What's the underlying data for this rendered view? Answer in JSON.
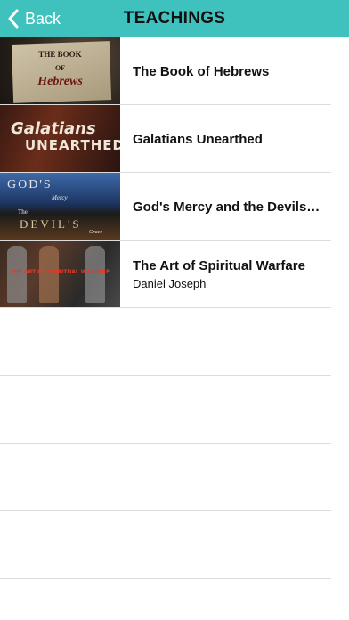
{
  "nav": {
    "back_label": "Back",
    "title": "TEACHINGS"
  },
  "items": [
    {
      "title": "The Book of Hebrews",
      "subtitle": "",
      "thumb": {
        "line1": "THE BOOK",
        "line2": "OF",
        "line3": "Hebrews"
      }
    },
    {
      "title": "Galatians Unearthed",
      "subtitle": "",
      "thumb": {
        "line1": "Galatians",
        "line2": "UNEARTHED"
      }
    },
    {
      "title": "God's Mercy and the Devils…",
      "subtitle": "",
      "thumb": {
        "line1": "GOD'S",
        "line2": "Mercy",
        "line3": "The",
        "line4": "DEVIL'S",
        "line5": "Grace"
      }
    },
    {
      "title": "The Art of Spiritual Warfare",
      "subtitle": "Daniel Joseph",
      "thumb": {
        "line1": "THE ART OF SPIRITUAL WARFARE"
      }
    }
  ],
  "colors": {
    "navbar": "#3fc2be",
    "separator": "#dcdcdc"
  }
}
